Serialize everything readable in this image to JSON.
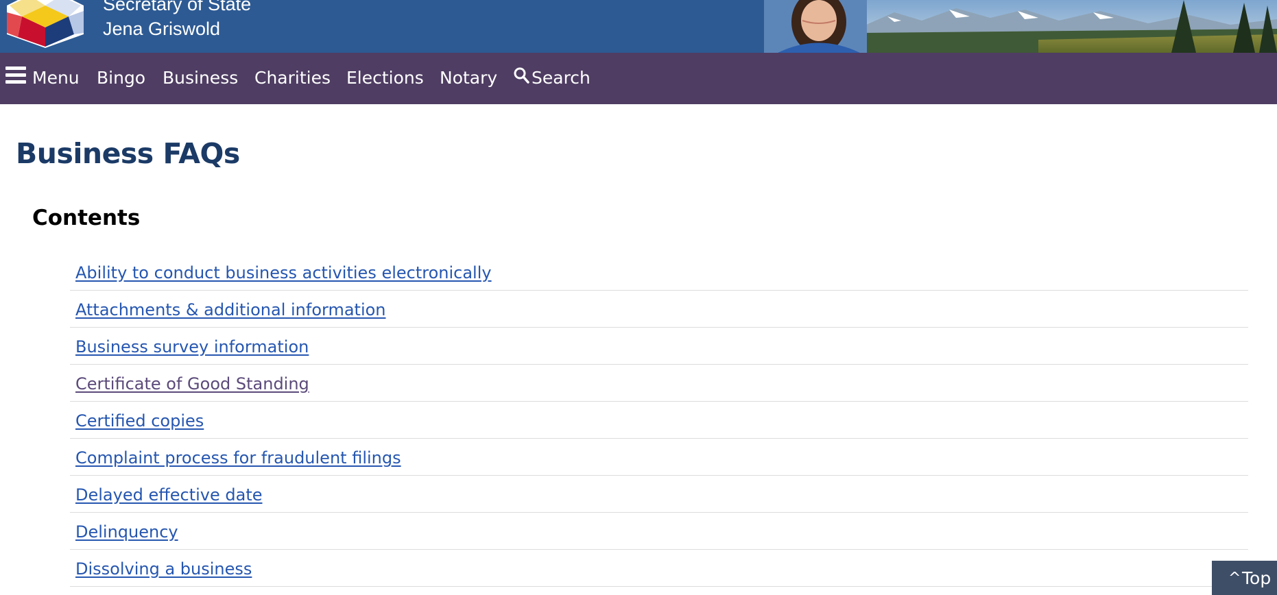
{
  "header": {
    "agency": "Secretary of State",
    "official": "Jena Griswold"
  },
  "nav": {
    "menu": "Menu",
    "bingo": "Bingo",
    "business": "Business",
    "charities": "Charities",
    "elections": "Elections",
    "notary": "Notary",
    "search": "Search"
  },
  "page": {
    "title": "Business FAQs",
    "contents_heading": "Contents"
  },
  "faq_links": [
    "Ability to conduct business activities electronically",
    "Attachments & additional information",
    "Business survey information",
    "Certificate of Good Standing",
    "Certified copies",
    "Complaint process for fraudulent filings",
    "Delayed effective date",
    "Delinquency",
    "Dissolving a business"
  ],
  "top_button": {
    "label": "Top",
    "icon": "caret-up-icon"
  },
  "colors": {
    "header_blue": "#2d5a93",
    "nav_purple": "#4f3d63",
    "title_navy": "#1b3a66",
    "link_blue": "#2556b0",
    "link_visited": "#5b4a7a",
    "top_button": "#3f4e67"
  }
}
